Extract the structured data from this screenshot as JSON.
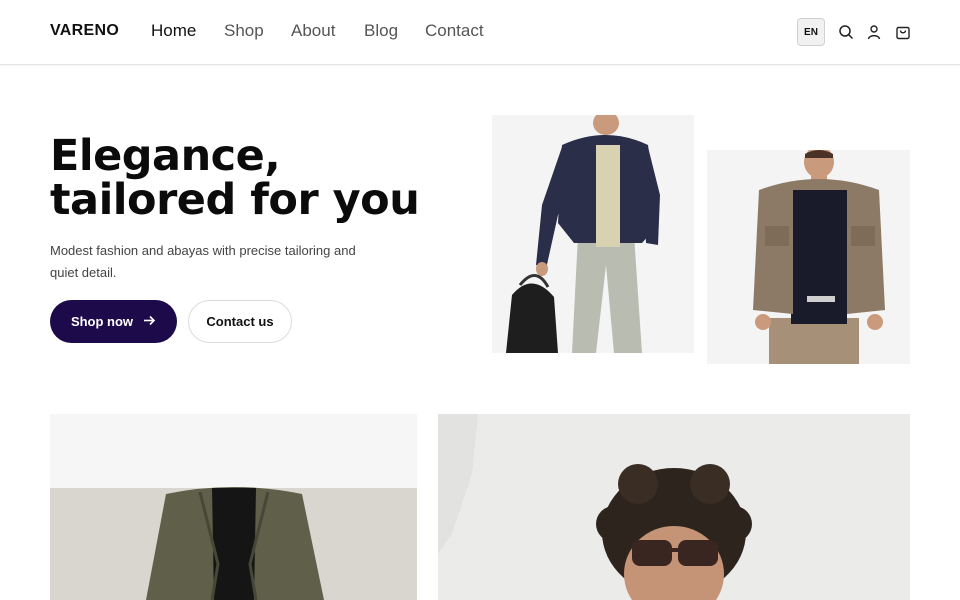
{
  "header": {
    "logo": "VARENO",
    "nav": [
      {
        "label": "Home",
        "active": true
      },
      {
        "label": "Shop",
        "active": false
      },
      {
        "label": "About",
        "active": false
      },
      {
        "label": "Blog",
        "active": false
      },
      {
        "label": "Contact",
        "active": false
      }
    ],
    "language": "EN",
    "icons": [
      "search-icon",
      "user-icon",
      "shopping-bag-icon"
    ]
  },
  "hero": {
    "title": "Elegance, tailored for you",
    "subtitle": "Modest fashion and abayas with precise tailoring and quiet detail.",
    "primary_button": "Shop now",
    "primary_icon": "arrow-right-icon",
    "secondary_button": "Contact us"
  },
  "colors": {
    "primary_button_bg": "#1d0a4a",
    "text_dark": "#111111",
    "muted_text": "#444444",
    "nav_inactive": "#555555"
  }
}
